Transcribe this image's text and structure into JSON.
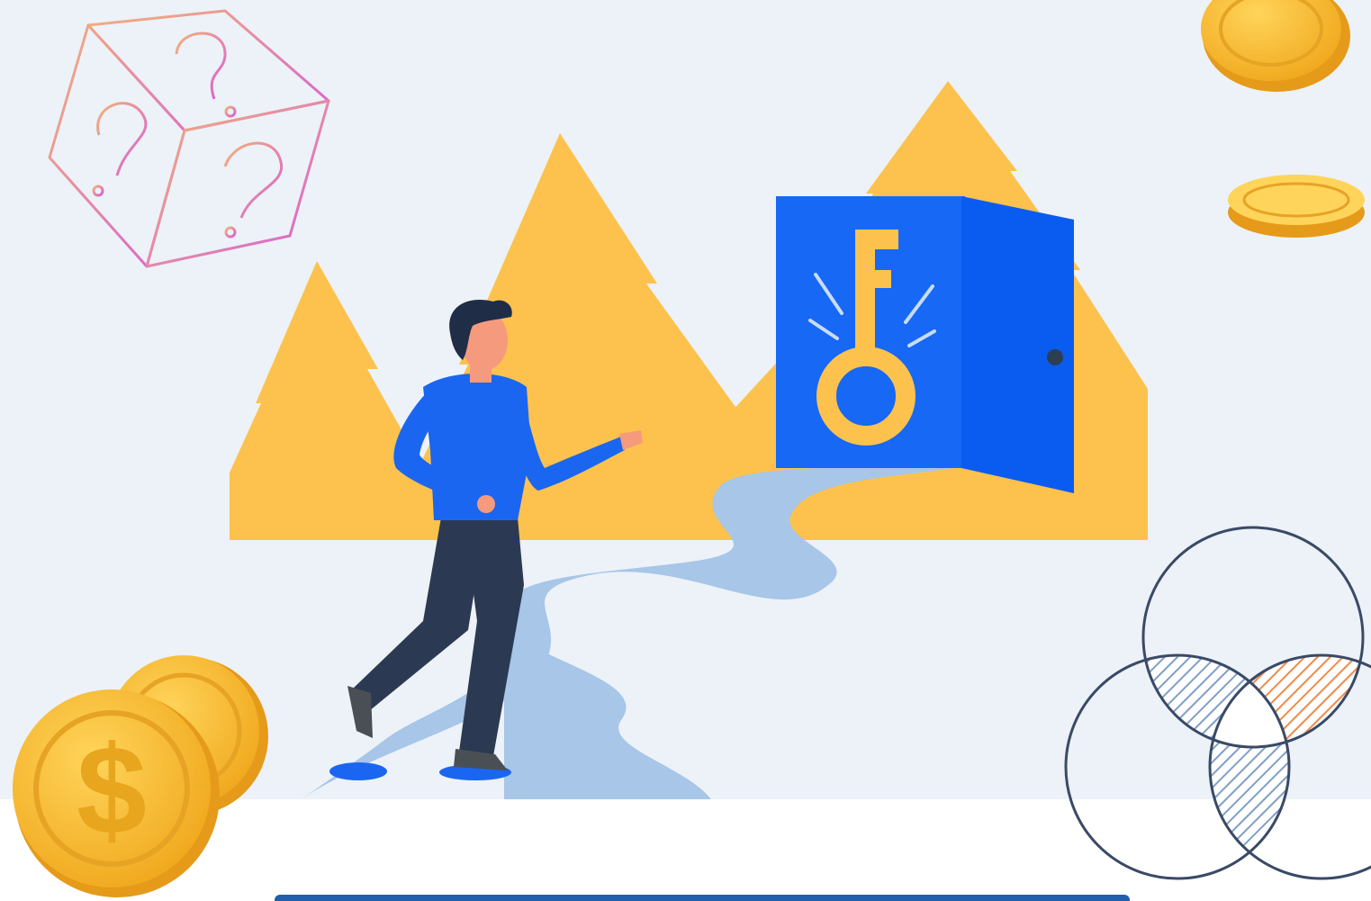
{
  "illustration": {
    "colors": {
      "background": "#edf2f8",
      "ground": "#ffffff",
      "mountain": "#fcc24d",
      "door_front": "#1668f5",
      "door_panel": "#0a5cf0",
      "key": "#fcc24d",
      "path": "#a7c6e8",
      "shirt": "#1b66f0",
      "pants": "#2b3a52",
      "skin": "#f59a7c",
      "hair": "#1f2d46",
      "coin": "#f6b733",
      "cube_stroke_start": "#f2b27a",
      "cube_stroke_end": "#d75fd6",
      "venn_stroke": "#3a4a66",
      "hatch_blue": "#7f9fc7",
      "hatch_orange": "#f08a4a",
      "bottom_bar": "#1f5fae"
    },
    "icons": [
      "question-cube-icon",
      "dollar-coin-icon",
      "gold-coin-icon",
      "venn-diagram-icon",
      "key-icon",
      "door-icon"
    ],
    "coin_symbol": "$"
  }
}
